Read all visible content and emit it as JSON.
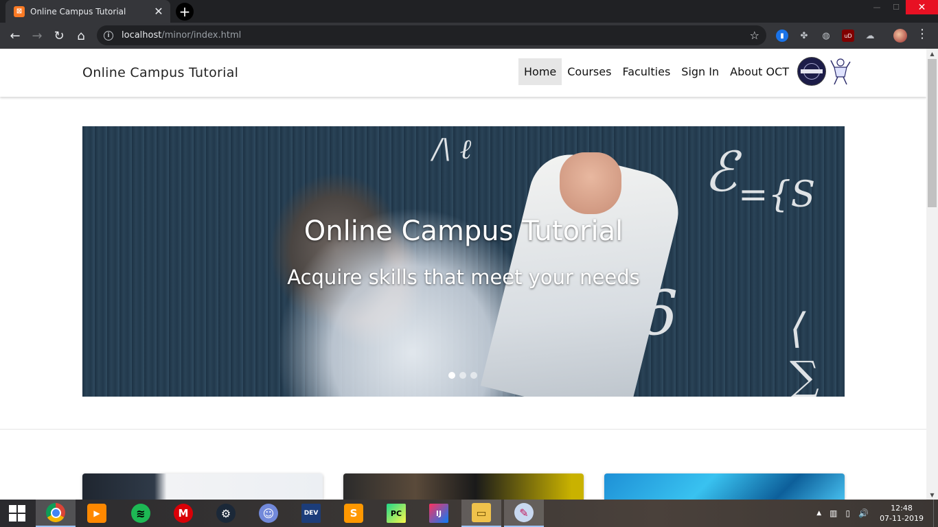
{
  "browser": {
    "tab": {
      "title": "Online Campus Tutorial",
      "favicon": "xampp-icon",
      "close": "✕"
    },
    "new_tab": "+",
    "window_controls": {
      "minimize": "—",
      "maximize": "☐",
      "close": "✕"
    },
    "nav": {
      "back": "←",
      "forward": "→",
      "reload": "↻",
      "home": "⌂"
    },
    "address": {
      "host": "localhost",
      "path": "/minor/index.html"
    },
    "star": "☆",
    "extensions": {
      "bookmark": "▮",
      "puzzle": "✤",
      "bulb": "◍",
      "ublock": "uD",
      "cloud": "☁"
    },
    "menu": "⋮"
  },
  "site": {
    "brand": "Online Campus Tutorial",
    "menu": [
      {
        "label": "Home",
        "active": true
      },
      {
        "label": "Courses"
      },
      {
        "label": "Faculties"
      },
      {
        "label": "Sign In"
      },
      {
        "label": "About OCT"
      }
    ],
    "carousel": {
      "title": "Online Campus Tutorial",
      "subtitle": "Acquire skills that meet your needs",
      "slides_count": 3,
      "active_slide": 1
    }
  },
  "scrollbar": {
    "up": "▲",
    "down": "▼"
  },
  "taskbar": {
    "apps": [
      "chrome",
      "vlc",
      "spotify",
      "mega",
      "steam",
      "discord",
      "devcpp",
      "sublime",
      "pycharm",
      "intellij",
      "file-explorer",
      "paint"
    ],
    "app_glyphs": {
      "vlc": "▶",
      "spotify": "≋",
      "mega": "M",
      "steam": "⚙",
      "discord": "☺",
      "devcpp": "DEV",
      "sublime": "S",
      "pycharm": "PC",
      "intellij": "IJ",
      "file-explorer": "▭",
      "paint": "✎"
    },
    "tray": {
      "chevron": "▲",
      "network": "▥",
      "battery": "▯",
      "volume": "🔊"
    },
    "time": "12:48",
    "date": "07-11-2019"
  },
  "colors": {
    "chrome_dark": "#202124",
    "close_red": "#e81123",
    "nav_active": "#e6e6e6"
  }
}
